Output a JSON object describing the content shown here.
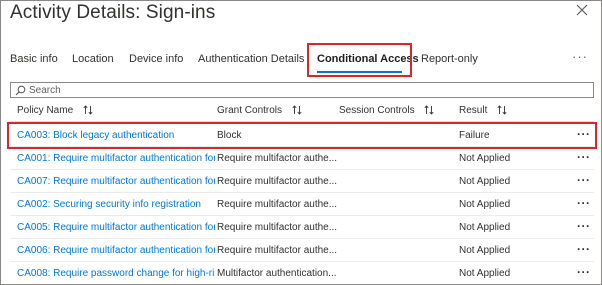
{
  "panel": {
    "title": "Activity Details: Sign-ins",
    "close_icon": "close-icon"
  },
  "tabs": [
    {
      "label": "Basic info"
    },
    {
      "label": "Location"
    },
    {
      "label": "Device info"
    },
    {
      "label": "Authentication Details"
    },
    {
      "label": "Conditional Access",
      "active": true
    },
    {
      "label": "Report-only"
    }
  ],
  "more_tabs_label": "···",
  "search": {
    "placeholder": "Search",
    "icon": "search-icon"
  },
  "table": {
    "columns": [
      {
        "label": "Policy Name"
      },
      {
        "label": "Grant Controls"
      },
      {
        "label": "Session Controls"
      },
      {
        "label": "Result"
      }
    ],
    "rows": [
      {
        "policy": "CA003: Block legacy authentication",
        "grant": "Block",
        "session": "",
        "result": "Failure",
        "more": "···"
      },
      {
        "policy": "CA001: Require multifactor authentication for...",
        "grant": "Require multifactor authe...",
        "session": "",
        "result": "Not Applied",
        "more": "···"
      },
      {
        "policy": "CA007: Require multifactor authentication for...",
        "grant": "Require multifactor authe...",
        "session": "",
        "result": "Not Applied",
        "more": "···"
      },
      {
        "policy": "CA002: Securing security info registration",
        "grant": "Require multifactor authe...",
        "session": "",
        "result": "Not Applied",
        "more": "···"
      },
      {
        "policy": "CA005: Require multifactor authentication for...",
        "grant": "Require multifactor authe...",
        "session": "",
        "result": "Not Applied",
        "more": "···"
      },
      {
        "policy": "CA006: Require multifactor authentication for...",
        "grant": "Require multifactor authe...",
        "session": "",
        "result": "Not Applied",
        "more": "···"
      },
      {
        "policy": "CA008: Require password change for high-ris...",
        "grant": "Multifactor authentication...",
        "session": "",
        "result": "Not Applied",
        "more": "···"
      }
    ]
  },
  "colors": {
    "accent": "#0078d4",
    "highlight": "#d9252c",
    "text": "#323130"
  }
}
